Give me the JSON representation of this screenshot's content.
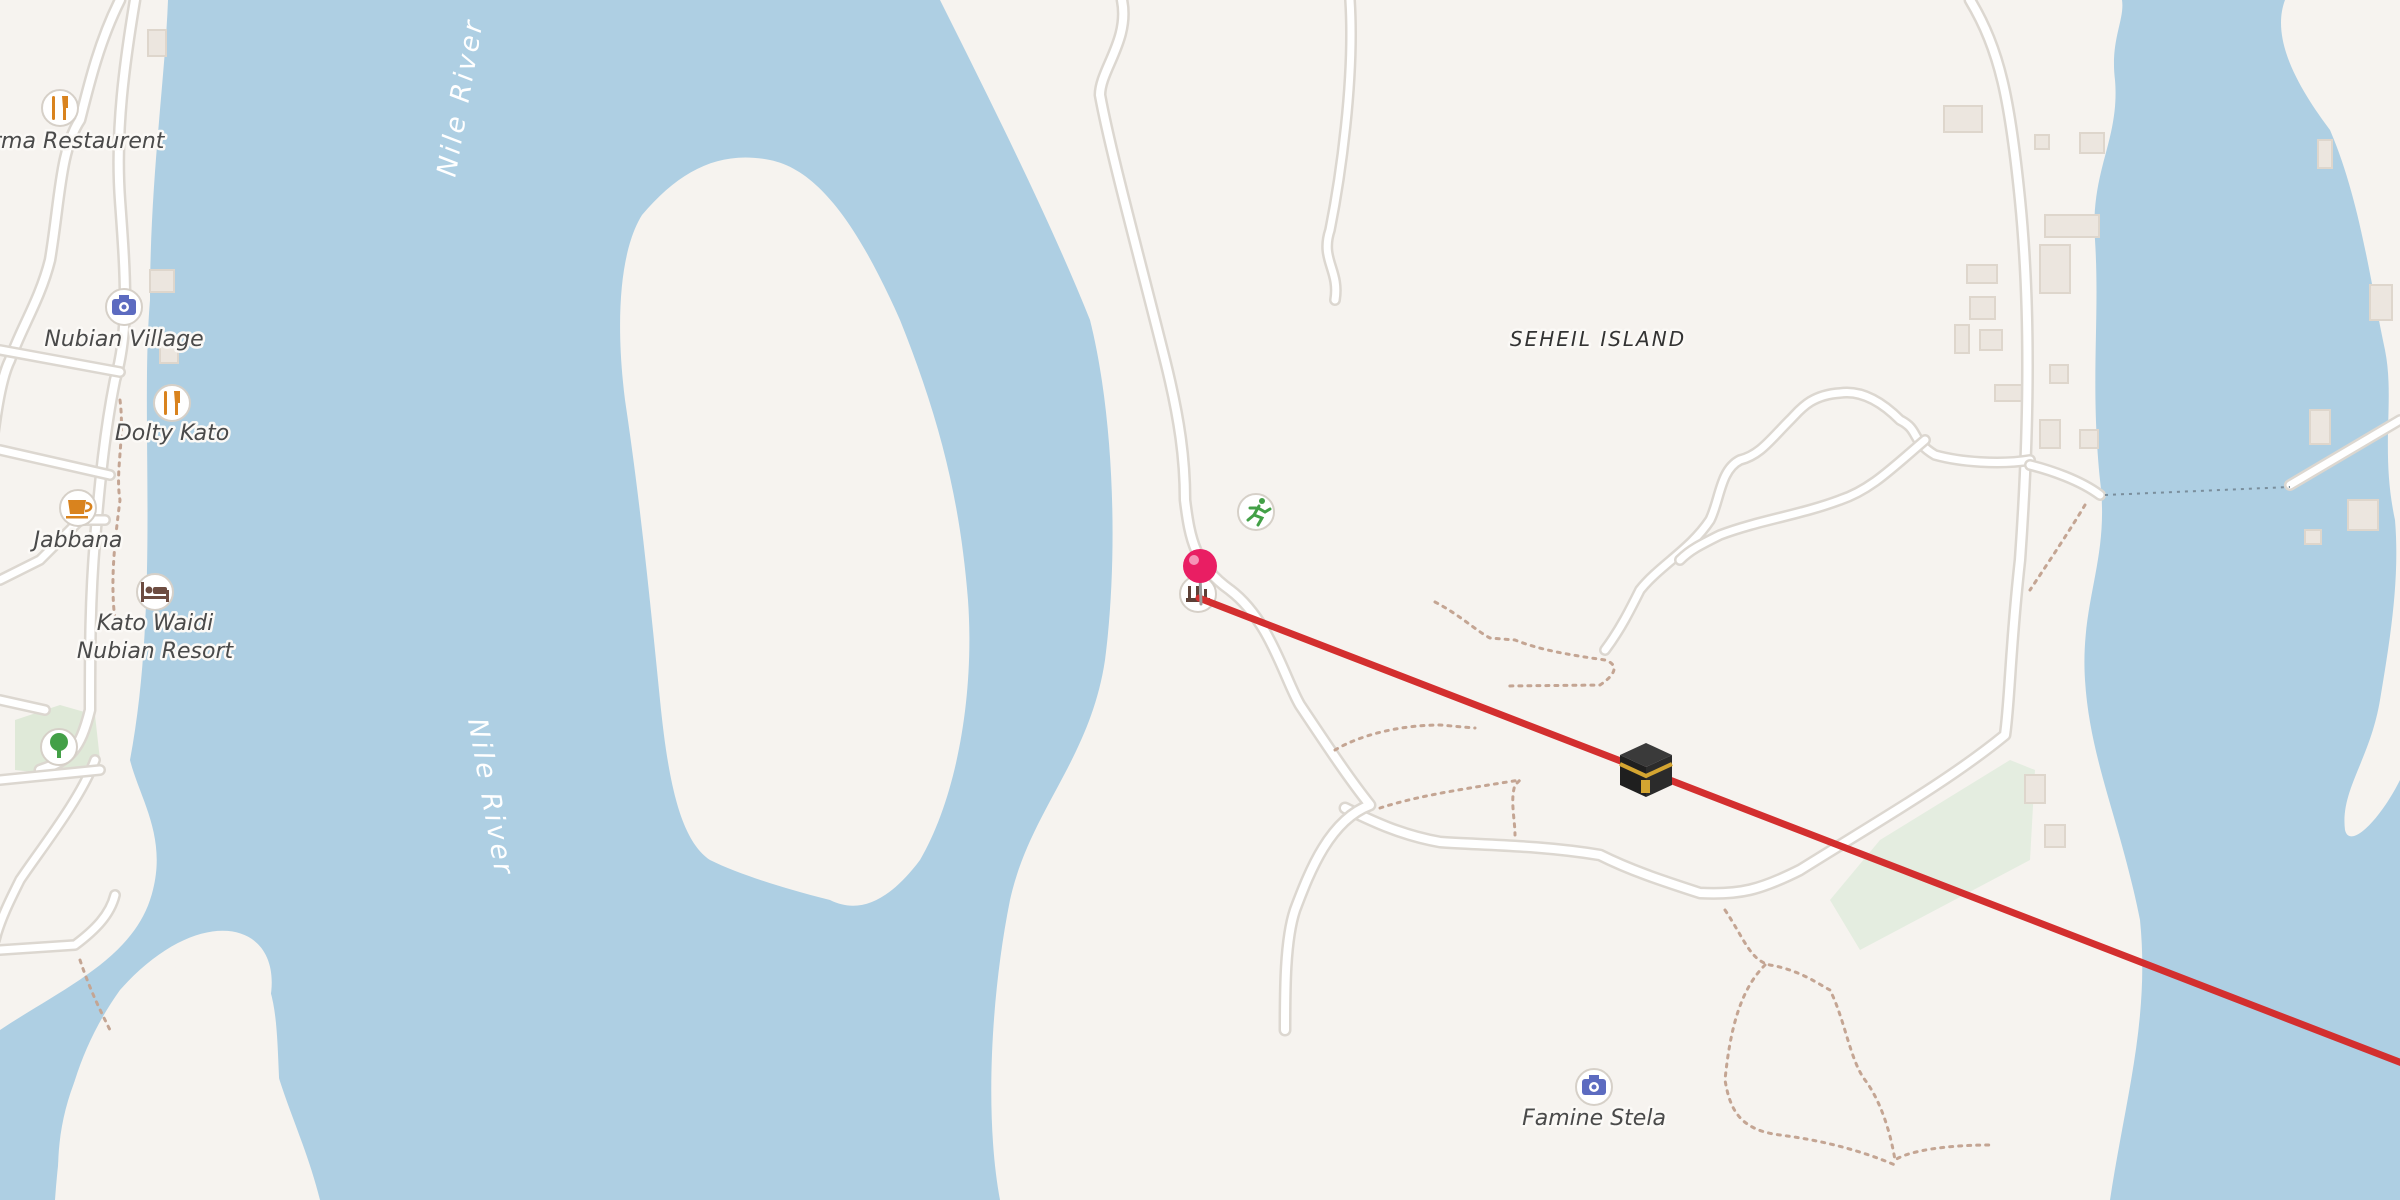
{
  "map": {
    "labels": {
      "river_north": "Nile River",
      "river_south": "Nile River",
      "island": "SEHEIL ISLAND"
    },
    "pois": [
      {
        "label": "rma Restaurent",
        "icon": "restaurant-icon"
      },
      {
        "label": "Nubian Village",
        "icon": "camera-icon"
      },
      {
        "label": "Dolty Kato",
        "icon": "restaurant-icon"
      },
      {
        "label": "Jabbana",
        "icon": "cafe-icon"
      },
      {
        "label": "Kato Waidi",
        "label2": "Nubian Resort",
        "icon": "hotel-icon"
      },
      {
        "label": "",
        "icon": "park-tree-icon"
      },
      {
        "label": "",
        "icon": "sport-running-icon"
      },
      {
        "label": "",
        "icon": "ruins-icon"
      },
      {
        "label": "Famine Stela",
        "icon": "camera-icon"
      }
    ],
    "marker": {
      "icon": "location-pin-icon",
      "color": "#e91e63"
    },
    "route": {
      "color": "#d32f2f",
      "destination_icon": "kaaba-icon"
    },
    "colors": {
      "land": "#f6f3ef",
      "water": "#aecfe3",
      "road": "#ffffff",
      "park": "#e4ede0",
      "poi_food": "#d9831e",
      "poi_sight": "#5c6bc0",
      "poi_park": "#43a047"
    }
  }
}
